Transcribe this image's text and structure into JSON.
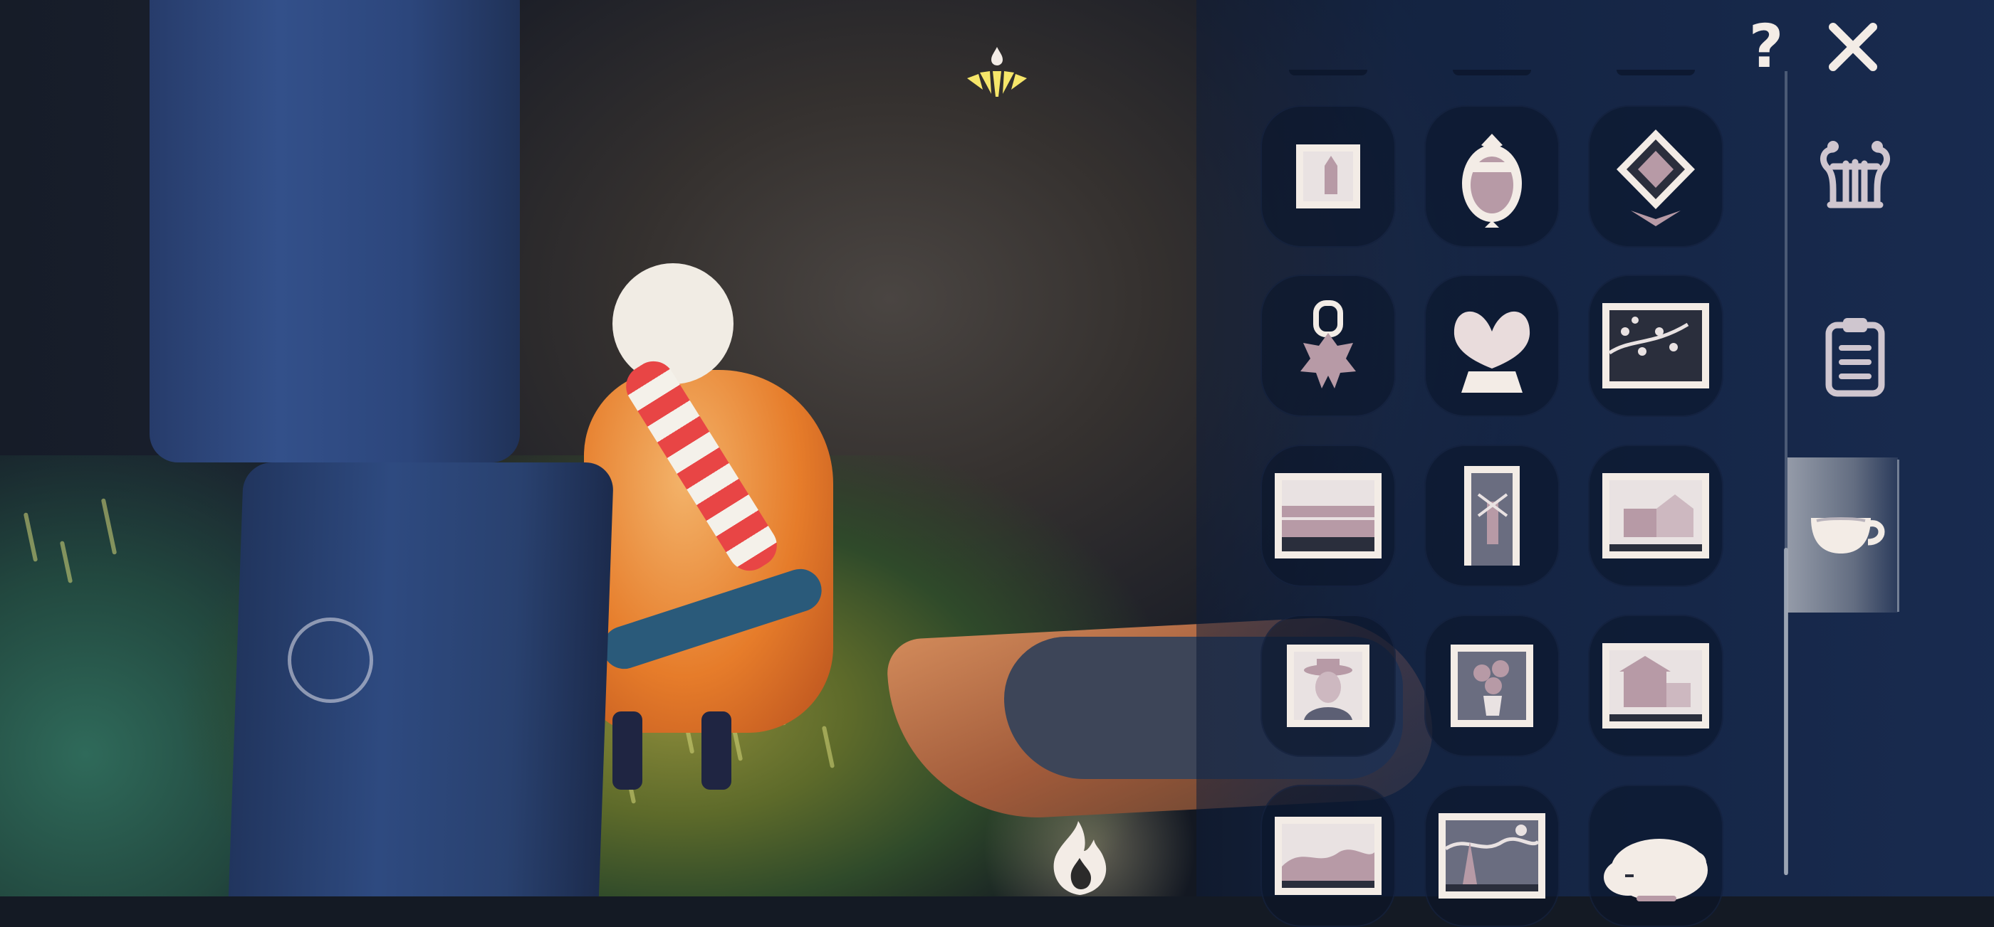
{
  "hud": {
    "help_label": "?",
    "icons": {
      "joystick": "joystick-ring-icon",
      "wing_level": "winged-light-fan-icon",
      "honk": "flame-icon",
      "close": "close-x-icon"
    }
  },
  "closet": {
    "selected_tab": "props",
    "tabs": [
      {
        "id": "instruments",
        "icon": "lyre-icon"
      },
      {
        "id": "outfits",
        "icon": "clipboard-icon"
      },
      {
        "id": "props",
        "icon": "teacup-icon"
      }
    ],
    "items": [
      {
        "icon": "framed-church-painting-icon"
      },
      {
        "icon": "oval-mirror-icon"
      },
      {
        "icon": "diamond-sign-icon"
      },
      {
        "icon": "star-lantern-icon"
      },
      {
        "icon": "heart-rock-icon"
      },
      {
        "icon": "blossom-painting-icon"
      },
      {
        "icon": "wheatfield-painting-icon"
      },
      {
        "icon": "windmill-painting-icon"
      },
      {
        "icon": "house-painting-icon"
      },
      {
        "icon": "portrait-with-hat-painting-icon"
      },
      {
        "icon": "sunflowers-painting-icon"
      },
      {
        "icon": "yellow-house-painting-icon"
      },
      {
        "icon": "landscape-painting-icon"
      },
      {
        "icon": "starry-night-painting-icon"
      },
      {
        "icon": "sleeping-manta-plush-icon"
      }
    ]
  },
  "colors": {
    "icon_cream": "#f3ece6",
    "icon_mauve": "#b79aa6",
    "wing_light": "#f6e66a",
    "panel_blue": "#1a305c"
  }
}
